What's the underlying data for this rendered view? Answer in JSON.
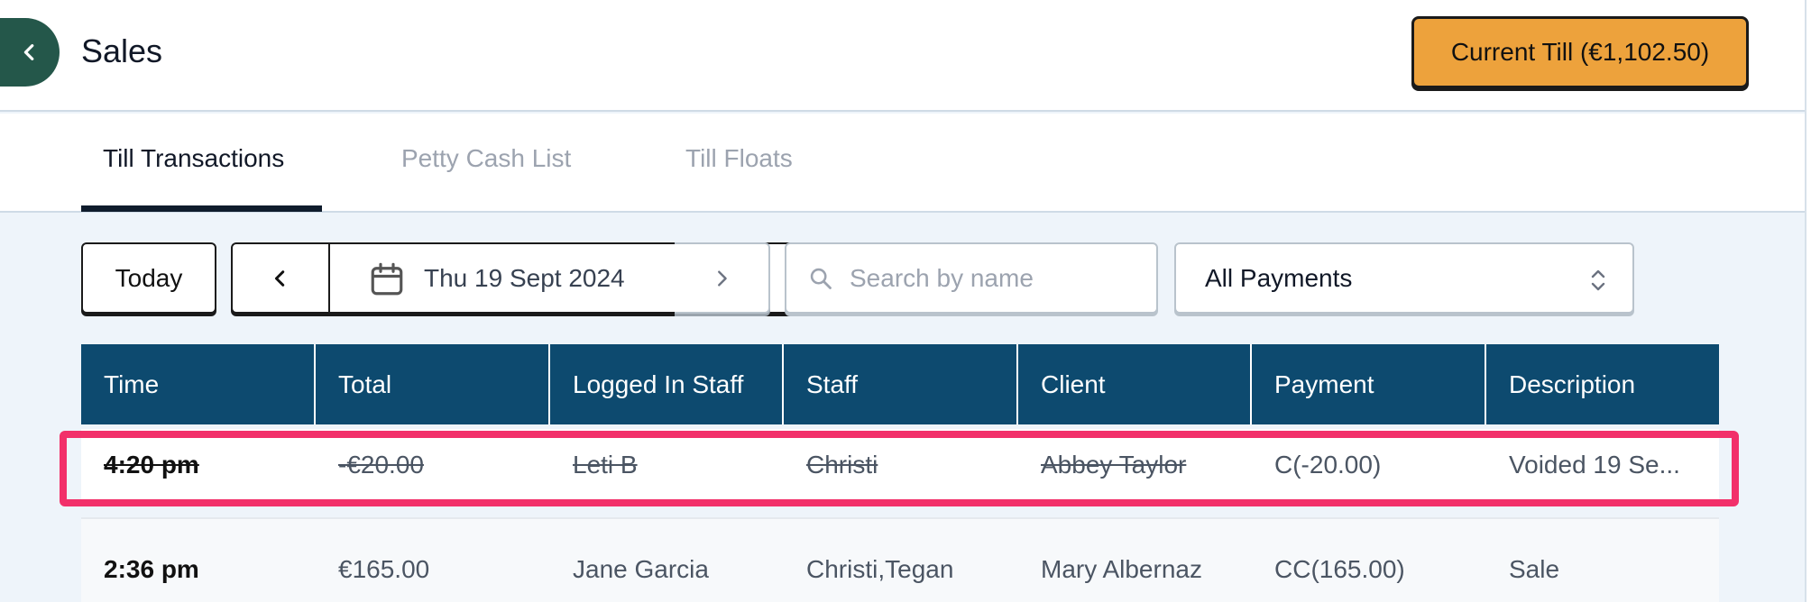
{
  "header": {
    "title": "Sales",
    "current_till_label": "Current Till (€1,102.50)"
  },
  "tabs": [
    {
      "label": "Till Transactions",
      "active": true
    },
    {
      "label": "Petty Cash List",
      "active": false
    },
    {
      "label": "Till Floats",
      "active": false
    }
  ],
  "toolbar": {
    "today_label": "Today",
    "date_label": "Thu 19 Sept 2024",
    "search_placeholder": "Search by name",
    "payment_filter": "All Payments"
  },
  "table": {
    "columns": [
      "Time",
      "Total",
      "Logged In Staff",
      "Staff",
      "Client",
      "Payment",
      "Description"
    ],
    "rows": [
      {
        "time": "4:20 pm",
        "total": "-€20.00",
        "logged_in_staff": "Leti B",
        "staff": "Christi",
        "client": "Abbey Taylor",
        "payment": "C(-20.00)",
        "description": "Voided 19 Se...",
        "voided": true
      },
      {
        "time": "2:36 pm",
        "total": "€165.00",
        "logged_in_staff": "Jane Garcia",
        "staff": "Christi,Tegan",
        "client": "Mary Albernaz",
        "payment": "CC(165.00)",
        "description": "Sale",
        "voided": false
      }
    ]
  },
  "colors": {
    "accent_orange": "#eda23c",
    "table_header": "#0d4a6f",
    "back_button": "#24574a",
    "highlight": "#f2306a"
  }
}
